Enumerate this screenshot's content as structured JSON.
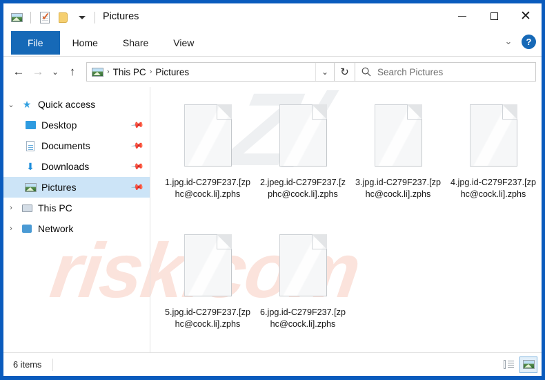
{
  "window": {
    "title": "Pictures",
    "quick_access_toolbar": [
      {
        "icon": "picture-icon",
        "name": "pictures-properties-icon"
      },
      {
        "icon": "properties-icon",
        "name": "properties-icon"
      },
      {
        "icon": "new-folder-icon",
        "name": "new-folder-icon"
      }
    ],
    "controls": {
      "minimize": "—",
      "maximize": "□",
      "close": "×"
    }
  },
  "ribbon": {
    "tabs": [
      {
        "label": "File",
        "active": true
      },
      {
        "label": "Home",
        "active": false
      },
      {
        "label": "Share",
        "active": false
      },
      {
        "label": "View",
        "active": false
      }
    ],
    "collapse_icon": "⌄",
    "help_label": "?"
  },
  "navbar": {
    "back_icon": "←",
    "forward_icon": "→",
    "recent_icon": "⌄",
    "up_icon": "↑",
    "breadcrumb": [
      "This PC",
      "Pictures"
    ],
    "breadcrumb_separator": "›",
    "address_caret": "⌄",
    "refresh_icon": "↻"
  },
  "search": {
    "placeholder": "Search Pictures",
    "value": "",
    "icon": "search-icon"
  },
  "sidebar": {
    "items": [
      {
        "label": "Quick access",
        "icon": "star-icon",
        "expander": "⌄",
        "indent": false,
        "pinned": false,
        "selected": false
      },
      {
        "label": "Desktop",
        "icon": "desktop-icon",
        "expander": "",
        "indent": true,
        "pinned": true,
        "selected": false
      },
      {
        "label": "Documents",
        "icon": "documents-icon",
        "expander": "",
        "indent": true,
        "pinned": true,
        "selected": false
      },
      {
        "label": "Downloads",
        "icon": "download-icon",
        "expander": "",
        "indent": true,
        "pinned": true,
        "selected": false
      },
      {
        "label": "Pictures",
        "icon": "picture-icon",
        "expander": "",
        "indent": true,
        "pinned": true,
        "selected": true
      },
      {
        "label": "This PC",
        "icon": "computer-icon",
        "expander": "›",
        "indent": false,
        "pinned": false,
        "selected": false
      },
      {
        "label": "Network",
        "icon": "network-icon",
        "expander": "›",
        "indent": false,
        "pinned": false,
        "selected": false
      }
    ],
    "pin_glyph": "📌"
  },
  "files": [
    {
      "name": "1.jpg.id-C279F237.[zphc@cock.li].zphs",
      "icon": "blank-file-icon"
    },
    {
      "name": "2.jpeg.id-C279F237.[zphc@cock.li].zphs",
      "icon": "blank-file-icon"
    },
    {
      "name": "3.jpg.id-C279F237.[zphc@cock.li].zphs",
      "icon": "blank-file-icon"
    },
    {
      "name": "4.jpg.id-C279F237.[zphc@cock.li].zphs",
      "icon": "blank-file-icon"
    },
    {
      "name": "5.jpg.id-C279F237.[zphc@cock.li].zphs",
      "icon": "blank-file-icon"
    },
    {
      "name": "6.jpg.id-C279F237.[zphc@cock.li].zphs",
      "icon": "blank-file-icon"
    }
  ],
  "status": {
    "item_count": "6 items",
    "details_view": "details-view-icon",
    "large_icons_view": "large-icons-view-icon"
  },
  "watermark": {
    "top_text": "Z/",
    "bottom_text": "risk.com",
    "grey_color": "#eef0f2",
    "orange_color": "#fbe3dc"
  },
  "colors": {
    "frame_blue": "#0a5bbd",
    "accent_blue": "#1669b7",
    "selection_blue": "#cce4f7"
  }
}
